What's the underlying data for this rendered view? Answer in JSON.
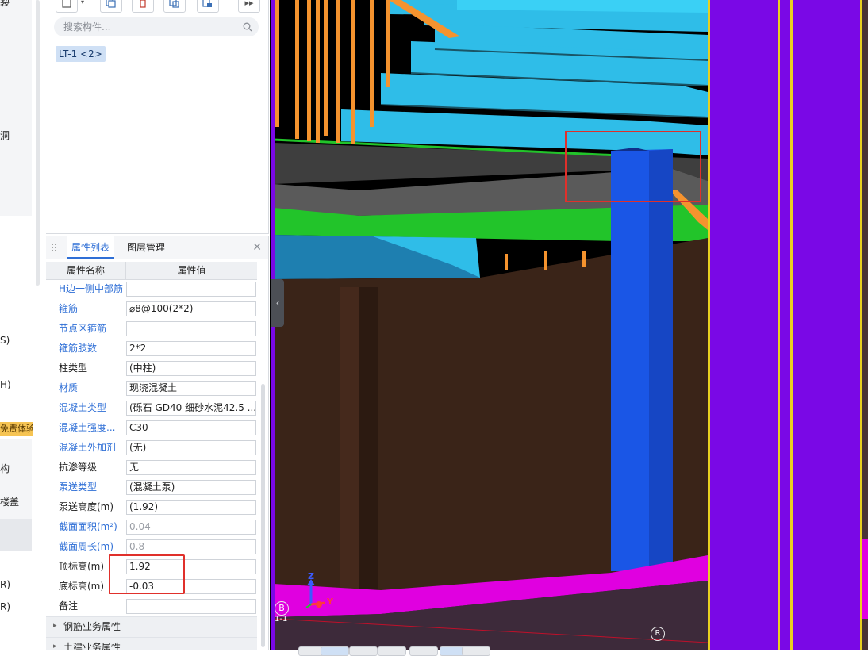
{
  "left_strip": {
    "items": [
      "裂",
      "洞",
      "S)",
      "H)",
      "构",
      "楼盖",
      "R)",
      "R)"
    ],
    "promo": "免费体验"
  },
  "tree_panel": {
    "search_placeholder": "搜索构件...",
    "selected_item": "LT-1 <2>",
    "more_button": "▸▸"
  },
  "prop_panel": {
    "tabs": [
      "属性列表",
      "图层管理"
    ],
    "columns": [
      "属性名称",
      "属性值"
    ],
    "rows": [
      {
        "name": "H边一侧中部筋",
        "value": "",
        "style": "blue"
      },
      {
        "name": "箍筋",
        "value": "⌀8@100(2*2)",
        "style": "blue"
      },
      {
        "name": "节点区箍筋",
        "value": "",
        "style": "blue"
      },
      {
        "name": "箍筋肢数",
        "value": "2*2",
        "style": "blue"
      },
      {
        "name": "柱类型",
        "value": "(中柱)",
        "style": "black"
      },
      {
        "name": "材质",
        "value": "现浇混凝土",
        "style": "blue"
      },
      {
        "name": "混凝土类型",
        "value": "(砾石 GD40 细砂水泥42.5 ...",
        "style": "blue"
      },
      {
        "name": "混凝土强度...",
        "value": "C30",
        "style": "blue"
      },
      {
        "name": "混凝土外加剂",
        "value": "(无)",
        "style": "blue"
      },
      {
        "name": "抗渗等级",
        "value": "无",
        "style": "black"
      },
      {
        "name": "泵送类型",
        "value": "(混凝土泵)",
        "style": "blue"
      },
      {
        "name": "泵送高度(m)",
        "value": "(1.92)",
        "style": "black"
      },
      {
        "name": "截面面积(m²)",
        "value": "0.04",
        "style": "blue",
        "gray": true
      },
      {
        "name": "截面周长(m)",
        "value": "0.8",
        "style": "blue",
        "gray": true
      },
      {
        "name": "顶标高(m)",
        "value": "1.92",
        "style": "black"
      },
      {
        "name": "底标高(m)",
        "value": "-0.03",
        "style": "black"
      },
      {
        "name": "备注",
        "value": "",
        "style": "black"
      }
    ],
    "groups": [
      "钢筋业务属性",
      "土建业务属性"
    ]
  },
  "viewport": {
    "axis_z": "Z",
    "axis_y": "Y",
    "grid_b": "B",
    "grid_11": "1-1",
    "grid_r": "R"
  },
  "colors": {
    "accent": "#2f6fd6",
    "annotation": "#e0302b",
    "stair": "#2fbde8",
    "column": "#1a56e6",
    "wall": "#3a2418",
    "slab": "#22c42a",
    "boundary": "#7a08e6",
    "base": "#e000e0"
  }
}
